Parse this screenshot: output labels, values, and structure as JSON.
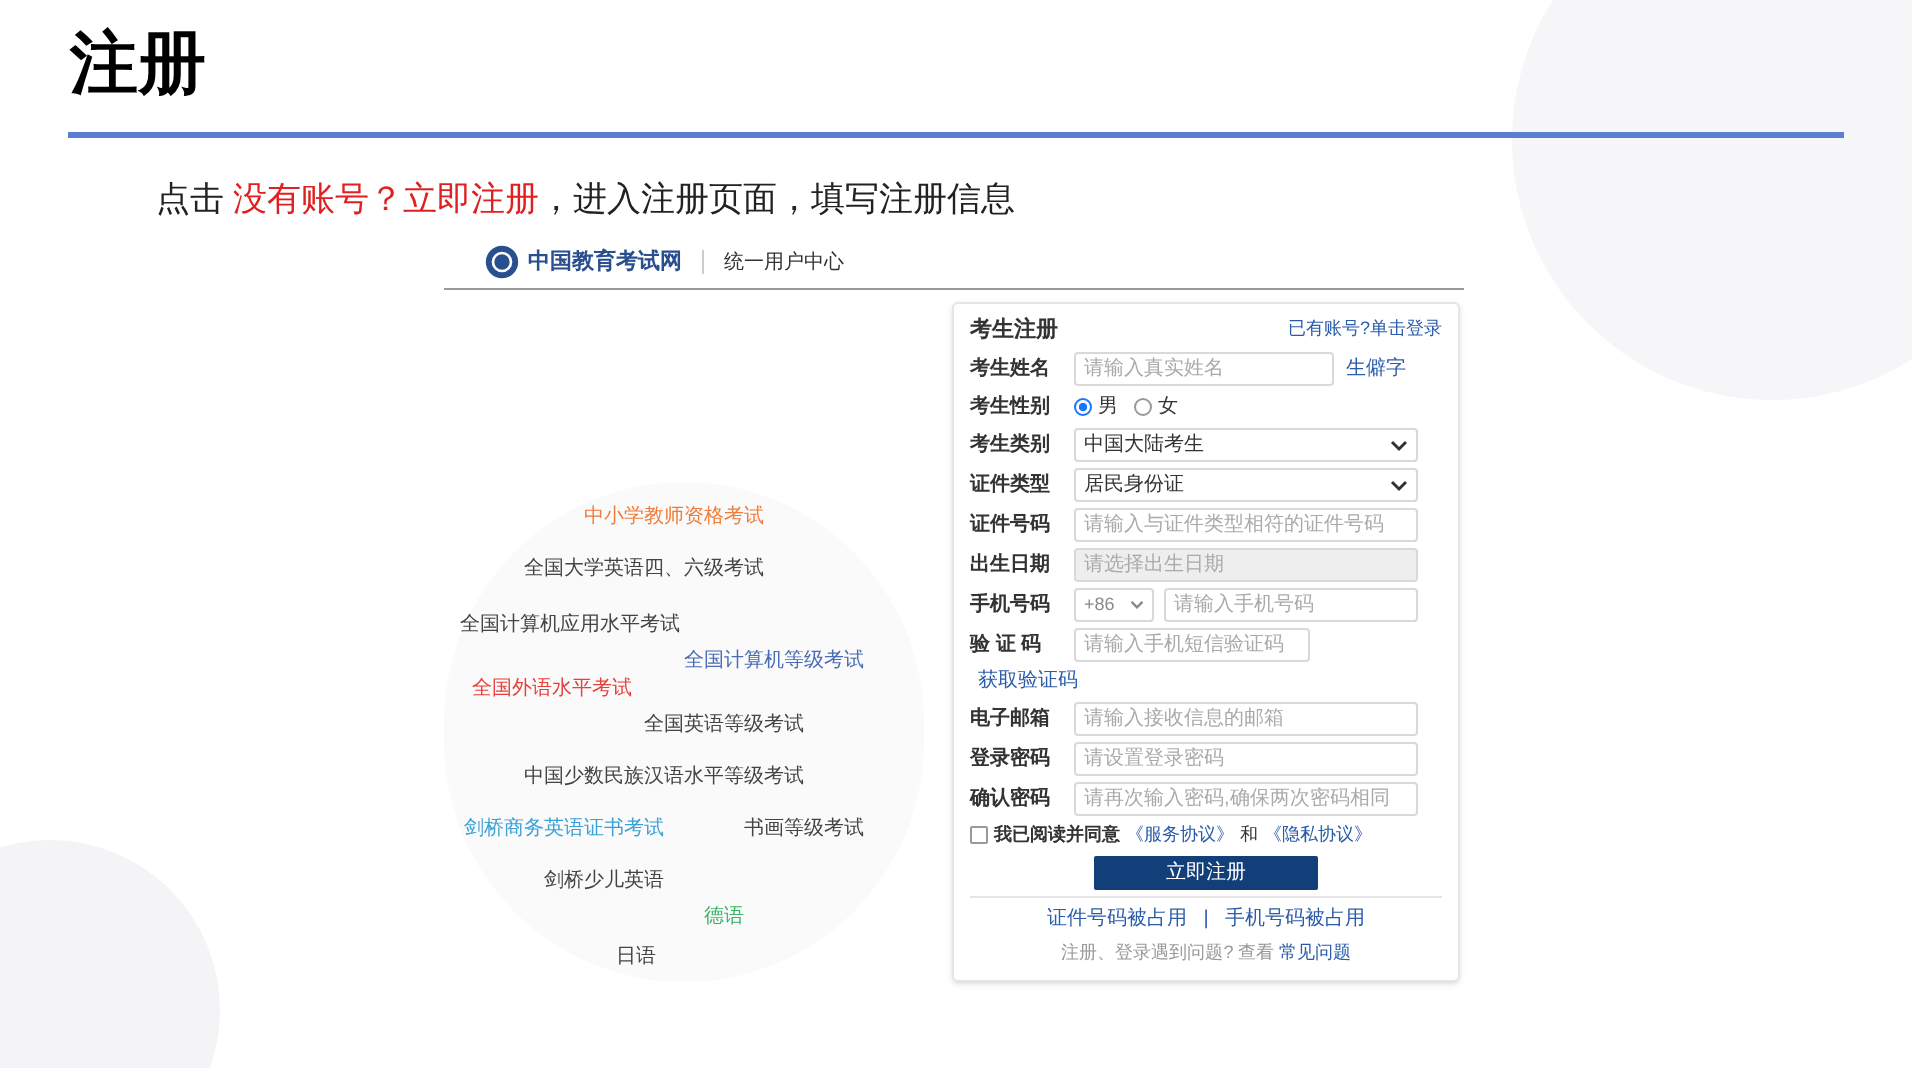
{
  "slide": {
    "title": "注册",
    "instruction": {
      "before": "点击 ",
      "highlight": "没有账号？立即注册",
      "after": "，进入注册页面，填写注册信息"
    }
  },
  "header": {
    "logo_text": "中国教育考试网",
    "center_title": "统一用户中心"
  },
  "illustration": {
    "labels": [
      {
        "text": "中小学教师资格考试",
        "color": "#f07c3a"
      },
      {
        "text": "全国大学英语四、六级考试",
        "color": "#444444"
      },
      {
        "text": "全国计算机应用水平考试",
        "color": "#444444"
      },
      {
        "text": "全国计算机等级考试",
        "color": "#4a6bb5"
      },
      {
        "text": "全国外语水平考试",
        "color": "#e8403a"
      },
      {
        "text": "全国英语等级考试",
        "color": "#444444"
      },
      {
        "text": "中国少数民族汉语水平等级考试",
        "color": "#444444"
      },
      {
        "text": "剑桥商务英语证书考试",
        "color": "#3aa0d8"
      },
      {
        "text": "书画等级考试",
        "color": "#444444"
      },
      {
        "text": "剑桥少儿英语",
        "color": "#444444"
      },
      {
        "text": "德语",
        "color": "#3bb36a"
      },
      {
        "text": "日语",
        "color": "#444444"
      }
    ]
  },
  "form": {
    "title": "考生注册",
    "top_link": "已有账号?单击登录",
    "fields": [
      {
        "kind": "text",
        "label": "考生姓名",
        "placeholder": "请输入真实姓名",
        "side_link": "生僻字"
      },
      {
        "kind": "radio",
        "label": "考生性别",
        "options": [
          {
            "label": "男",
            "selected": true
          },
          {
            "label": "女",
            "selected": false
          }
        ]
      },
      {
        "kind": "select",
        "label": "考生类别",
        "value": "中国大陆考生"
      },
      {
        "kind": "select",
        "label": "证件类型",
        "value": "居民身份证"
      },
      {
        "kind": "text",
        "label": "证件号码",
        "placeholder": "请输入与证件类型相符的证件号码"
      },
      {
        "kind": "text",
        "label": "出生日期",
        "placeholder": "请选择出生日期",
        "disabled": true
      },
      {
        "kind": "phone",
        "label": "手机号码",
        "prefix": "+86",
        "placeholder": "请输入手机号码"
      },
      {
        "kind": "code",
        "label": "验 证 码",
        "placeholder": "请输入手机短信验证码",
        "link": "获取验证码"
      },
      {
        "kind": "text",
        "label": "电子邮箱",
        "placeholder": "请输入接收信息的邮箱"
      },
      {
        "kind": "text",
        "label": "登录密码",
        "placeholder": "请设置登录密码"
      },
      {
        "kind": "text",
        "label": "确认密码",
        "placeholder": "请再次输入密码,确保两次密码相同"
      }
    ],
    "agreement": {
      "checked": false,
      "text": "我已阅读并同意",
      "link1": "《服务协议》",
      "joiner": "和",
      "link2": "《隐私协议》"
    },
    "submit": "立即注册",
    "links": [
      "证件号码被占用",
      "手机号码被占用"
    ],
    "separator": "|",
    "help": {
      "text": "注册、登录遇到问题? 查看",
      "link": "常见问题"
    }
  }
}
